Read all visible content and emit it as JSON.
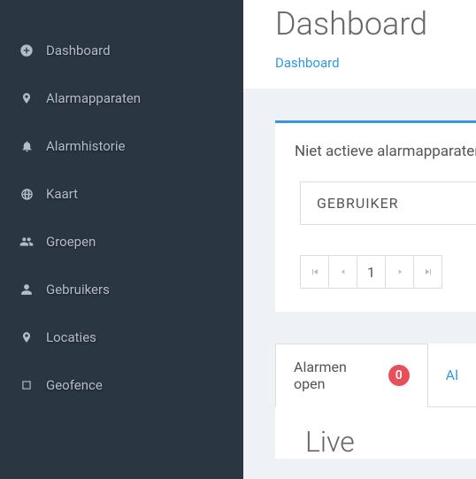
{
  "sidebar": {
    "items": [
      {
        "label": "Dashboard"
      },
      {
        "label": "Alarmapparaten"
      },
      {
        "label": "Alarmhistorie"
      },
      {
        "label": "Kaart"
      },
      {
        "label": "Groepen"
      },
      {
        "label": "Gebruikers"
      },
      {
        "label": "Locaties"
      },
      {
        "label": "Geofence"
      }
    ]
  },
  "header": {
    "title": "Dashboard",
    "breadcrumb": "Dashboard"
  },
  "card1": {
    "title": "Niet actieve alarmapparaten",
    "column_header": "GEBRUIKER",
    "page_current": "1"
  },
  "tabs": {
    "active_label": "Alarmen open",
    "active_badge": "0",
    "inactive_label": "Al"
  },
  "tab_content": "Live"
}
